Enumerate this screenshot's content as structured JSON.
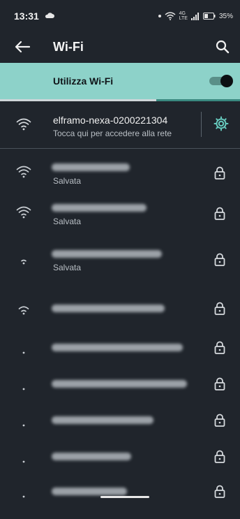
{
  "status_bar": {
    "time": "13:31",
    "battery_percent": "35%",
    "network_label_top": "4G",
    "network_label_bottom": "LTE"
  },
  "app_bar": {
    "title": "Wi-Fi"
  },
  "wifi_toggle": {
    "label": "Utilizza Wi-Fi",
    "enabled": true,
    "scan_progress": 0.65
  },
  "connected_network": {
    "ssid": "elframo-nexa-0200221304",
    "subtitle": "Tocca qui per accedere alla rete"
  },
  "networks": [
    {
      "status": "Salvata",
      "signal_level": 4,
      "secured": true
    },
    {
      "status": "Salvata",
      "signal_level": 4,
      "secured": true
    },
    {
      "status": "Salvata",
      "signal_level": 1,
      "secured": true
    },
    {
      "status": "",
      "signal_level": 2,
      "secured": true
    },
    {
      "status": "",
      "signal_level": 0,
      "secured": true
    },
    {
      "status": "",
      "signal_level": 0,
      "secured": true
    },
    {
      "status": "",
      "signal_level": 0,
      "secured": true
    },
    {
      "status": "",
      "signal_level": 0,
      "secured": true
    },
    {
      "status": "",
      "signal_level": 0,
      "secured": true
    }
  ],
  "colors": {
    "background": "#20252c",
    "toggle_bar": "#8dd2c9",
    "accent": "#66c9bd"
  }
}
